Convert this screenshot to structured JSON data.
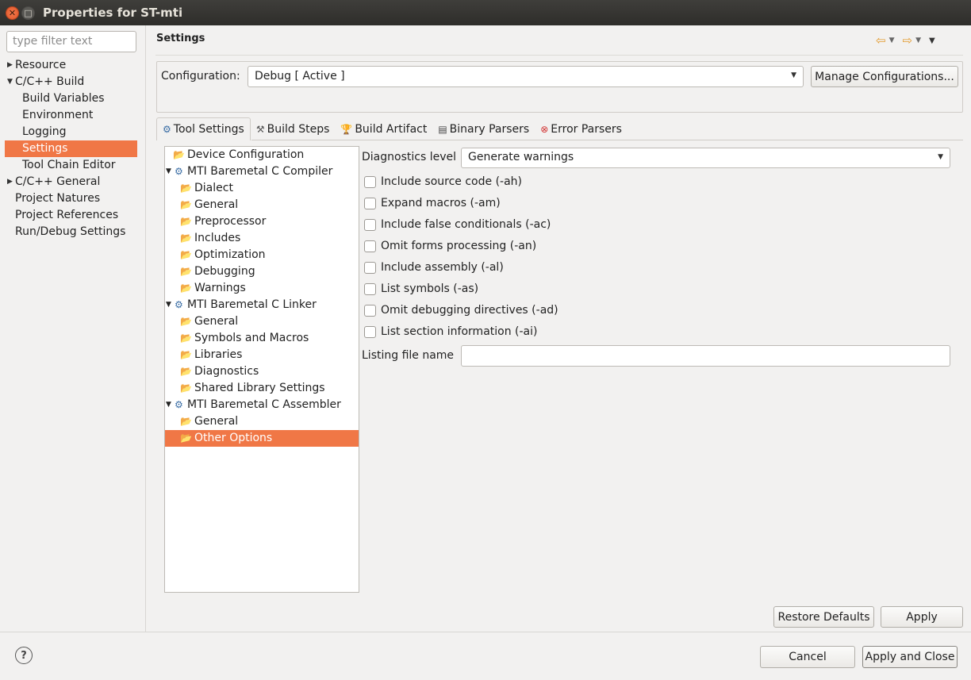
{
  "window": {
    "title": "Properties for ST-mti"
  },
  "filter": {
    "placeholder": "type filter text"
  },
  "nav": {
    "items": [
      {
        "label": "Resource",
        "level": 0,
        "twisty": "collapsed"
      },
      {
        "label": "C/C++ Build",
        "level": 0,
        "twisty": "expanded"
      },
      {
        "label": "Build Variables",
        "level": 1
      },
      {
        "label": "Environment",
        "level": 1
      },
      {
        "label": "Logging",
        "level": 1
      },
      {
        "label": "Settings",
        "level": 1,
        "selected": true
      },
      {
        "label": "Tool Chain Editor",
        "level": 1
      },
      {
        "label": "C/C++ General",
        "level": 0,
        "twisty": "collapsed"
      },
      {
        "label": "Project Natures",
        "level": 0
      },
      {
        "label": "Project References",
        "level": 0
      },
      {
        "label": "Run/Debug Settings",
        "level": 0
      }
    ]
  },
  "page": {
    "title": "Settings"
  },
  "config": {
    "label": "Configuration:",
    "value": "Debug  [ Active ]",
    "manage_label": "Manage Configurations..."
  },
  "tabs": [
    {
      "label": "Tool Settings",
      "icon": "tool-settings-icon",
      "active": true
    },
    {
      "label": "Build Steps",
      "icon": "build-steps-icon"
    },
    {
      "label": "Build Artifact",
      "icon": "trophy-icon"
    },
    {
      "label": "Binary Parsers",
      "icon": "binary-icon"
    },
    {
      "label": "Error Parsers",
      "icon": "error-icon"
    }
  ],
  "tree": {
    "items": [
      {
        "label": "Device Configuration",
        "type": "option"
      },
      {
        "label": "MTI Baremetal C Compiler",
        "type": "tool"
      },
      {
        "label": "Dialect",
        "type": "option",
        "indent": 1
      },
      {
        "label": "General",
        "type": "option",
        "indent": 1
      },
      {
        "label": "Preprocessor",
        "type": "option",
        "indent": 1
      },
      {
        "label": "Includes",
        "type": "option",
        "indent": 1
      },
      {
        "label": "Optimization",
        "type": "option",
        "indent": 1
      },
      {
        "label": "Debugging",
        "type": "option",
        "indent": 1
      },
      {
        "label": "Warnings",
        "type": "option",
        "indent": 1
      },
      {
        "label": "MTI Baremetal C Linker",
        "type": "tool"
      },
      {
        "label": "General",
        "type": "option",
        "indent": 1
      },
      {
        "label": "Symbols and Macros",
        "type": "option",
        "indent": 1
      },
      {
        "label": "Libraries",
        "type": "option",
        "indent": 1
      },
      {
        "label": "Diagnostics",
        "type": "option",
        "indent": 1
      },
      {
        "label": "Shared Library Settings",
        "type": "option",
        "indent": 1
      },
      {
        "label": "MTI Baremetal C Assembler",
        "type": "tool"
      },
      {
        "label": "General",
        "type": "option",
        "indent": 1
      },
      {
        "label": "Other Options",
        "type": "option",
        "indent": 1,
        "selected": true
      }
    ]
  },
  "diagnostics": {
    "label": "Diagnostics level",
    "value": "Generate warnings"
  },
  "options": [
    {
      "label": "Include source code (-ah)",
      "checked": false
    },
    {
      "label": "Expand macros (-am)",
      "checked": false
    },
    {
      "label": "Include false conditionals (-ac)",
      "checked": false
    },
    {
      "label": "Omit forms processing (-an)",
      "checked": false
    },
    {
      "label": "Include assembly (-al)",
      "checked": false
    },
    {
      "label": "List symbols (-as)",
      "checked": false
    },
    {
      "label": "Omit debugging directives (-ad)",
      "checked": false
    },
    {
      "label": "List section information (-ai)",
      "checked": false
    }
  ],
  "listing": {
    "label": "Listing file name",
    "value": ""
  },
  "buttons": {
    "restore_defaults": "Restore Defaults",
    "apply": "Apply",
    "cancel": "Cancel",
    "apply_close": "Apply and Close"
  },
  "colors": {
    "selection": "#f07746",
    "titlebar": "#3c3b37",
    "background": "#f2f1f0"
  }
}
